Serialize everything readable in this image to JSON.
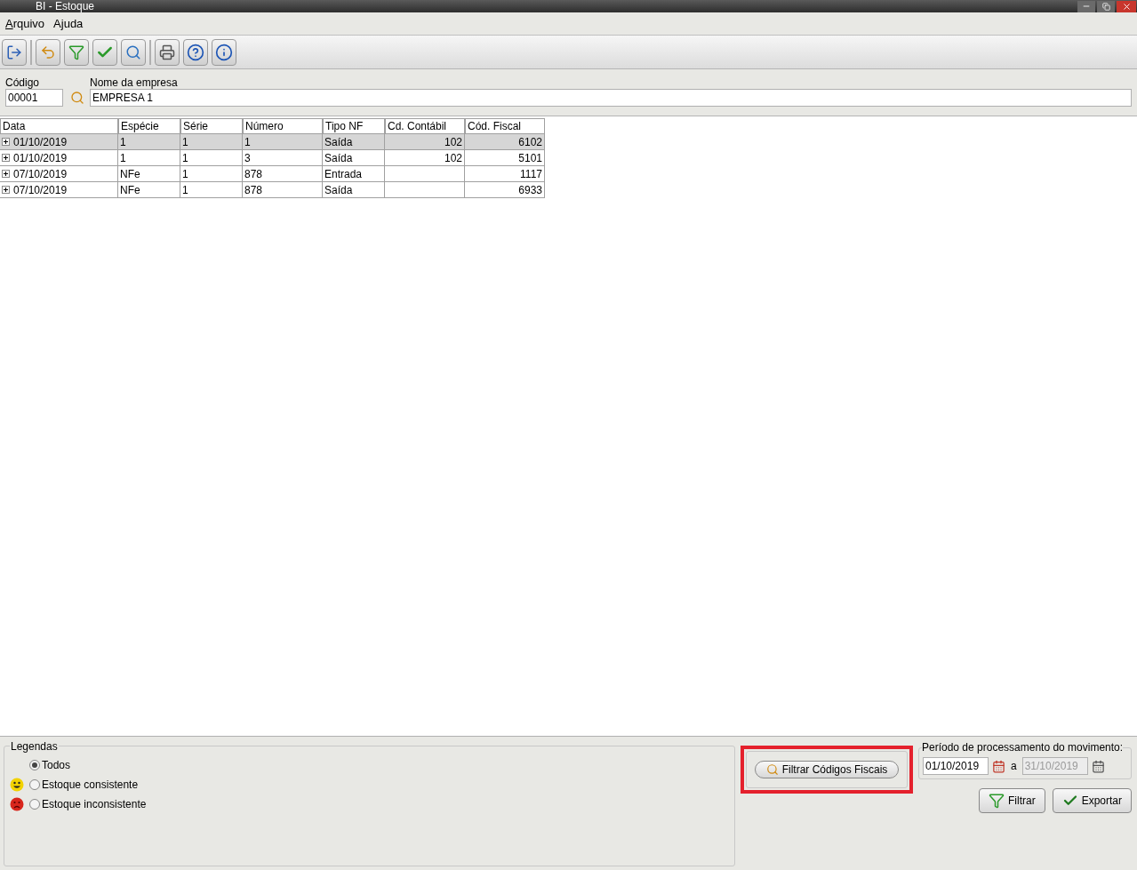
{
  "window": {
    "title": "BI - Estoque"
  },
  "menu": [
    {
      "mnemonic": "A",
      "rest": "rquivo"
    },
    {
      "rest": "Ajuda"
    }
  ],
  "company": {
    "code_label": "Código",
    "code_value": "00001",
    "name_label": "Nome da empresa",
    "name_value": "EMPRESA 1"
  },
  "table": {
    "columns": [
      "Data",
      "Espécie",
      "Série",
      "Número",
      "Tipo NF",
      "Cd. Contábil",
      "Cód. Fiscal"
    ],
    "rows": [
      {
        "selected": true,
        "expanded": false,
        "cells": [
          "01/10/2019",
          "1",
          "1",
          "1",
          "Saída",
          "102",
          "6102"
        ]
      },
      {
        "selected": false,
        "expanded": false,
        "cells": [
          "01/10/2019",
          "1",
          "1",
          "3",
          "Saída",
          "102",
          "5101"
        ]
      },
      {
        "selected": false,
        "expanded": false,
        "cells": [
          "07/10/2019",
          "NFe",
          "1",
          "878",
          "Entrada",
          "",
          "1117"
        ]
      },
      {
        "selected": false,
        "expanded": false,
        "cells": [
          "07/10/2019",
          "NFe",
          "1",
          "878",
          "Saída",
          "",
          "6933"
        ]
      }
    ]
  },
  "legend": {
    "title": "Legendas",
    "options": [
      {
        "label": "Todos",
        "selected": true,
        "kind": "none"
      },
      {
        "label": "Estoque consistente",
        "selected": false,
        "kind": "happy"
      },
      {
        "label": "Estoque inconsistente",
        "selected": false,
        "kind": "sad"
      }
    ]
  },
  "filter_codes_button": "Filtrar Códigos Fiscais",
  "period": {
    "title": "Período de processamento do movimento:",
    "start": "01/10/2019",
    "separator": "a",
    "end": "31/10/2019",
    "end_disabled": true
  },
  "buttons": [
    {
      "label": "Filtrar",
      "kind": "filter"
    },
    {
      "label": "Exportar",
      "kind": "export"
    }
  ]
}
